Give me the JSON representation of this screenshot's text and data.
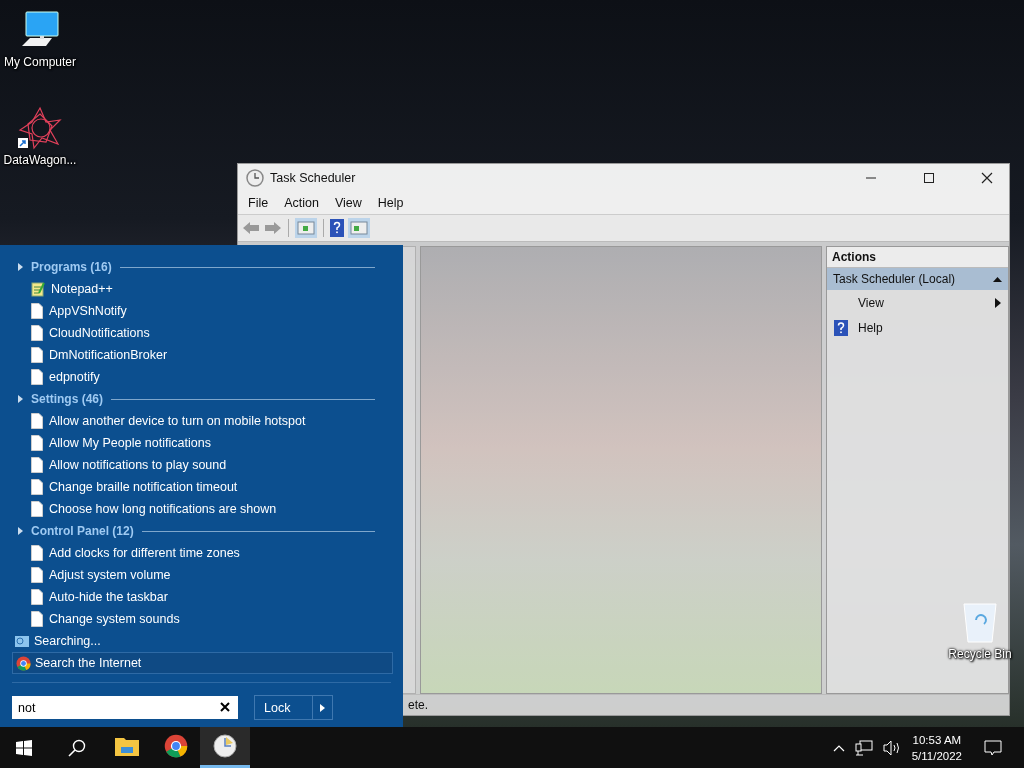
{
  "desktop_icons": [
    {
      "label": "My Computer",
      "kind": "computer"
    },
    {
      "label": "DataWagon...",
      "kind": "shortcut"
    },
    {
      "label": "Recycle Bin",
      "kind": "recycle"
    }
  ],
  "window": {
    "title": "Task Scheduler",
    "menu": [
      "File",
      "Action",
      "View",
      "Help"
    ],
    "actions_pane": {
      "title": "Actions",
      "group": {
        "label": "Task Scheduler (Local)",
        "expanded": true
      },
      "items": [
        {
          "label": "View",
          "kind": "submenu"
        },
        {
          "label": "Help",
          "kind": "help"
        }
      ]
    },
    "status_text": "ete."
  },
  "start_menu": {
    "sections": [
      {
        "title": "Programs (16)",
        "items": [
          {
            "label": "Notepad++",
            "kind": "notepad"
          },
          {
            "label": "AppVShNotify",
            "kind": "file"
          },
          {
            "label": "CloudNotifications",
            "kind": "file"
          },
          {
            "label": "DmNotificationBroker",
            "kind": "file"
          },
          {
            "label": "edpnotify",
            "kind": "file"
          }
        ]
      },
      {
        "title": "Settings (46)",
        "items": [
          {
            "label": "Allow another device to turn on mobile hotspot",
            "kind": "file"
          },
          {
            "label": "Allow My People notifications",
            "kind": "file"
          },
          {
            "label": "Allow notifications to play sound",
            "kind": "file"
          },
          {
            "label": "Change braille notification timeout",
            "kind": "file"
          },
          {
            "label": "Choose how long notifications are shown",
            "kind": "file"
          }
        ]
      },
      {
        "title": "Control Panel (12)",
        "items": [
          {
            "label": "Add clocks for different time zones",
            "kind": "file"
          },
          {
            "label": "Adjust system volume",
            "kind": "file"
          },
          {
            "label": "Auto-hide the taskbar",
            "kind": "file"
          },
          {
            "label": "Change system sounds",
            "kind": "file"
          }
        ]
      }
    ],
    "searching": "Searching...",
    "internet": "Search the Internet",
    "search": {
      "value": "not"
    },
    "power_button": "Lock"
  },
  "taskbar": {
    "apps": [
      {
        "kind": "folder",
        "active": false
      },
      {
        "kind": "browser",
        "active": false
      },
      {
        "kind": "clock",
        "active": true
      }
    ],
    "time": "10:53 AM",
    "date": "5/11/2022"
  }
}
